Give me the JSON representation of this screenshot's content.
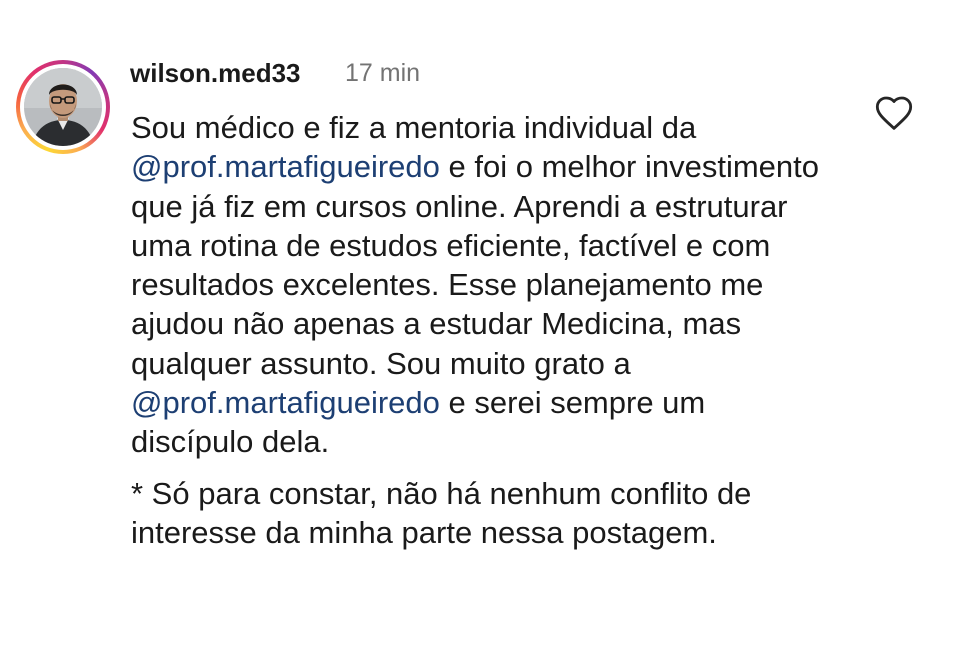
{
  "comment": {
    "username": "wilson.med33",
    "time": "17 min",
    "avatar_icon": "user-avatar-photo",
    "like_icon": "heart-outline-icon",
    "story_ring_colors": [
      "#fdd835",
      "#fbad50",
      "#e1306c",
      "#c13584",
      "#833ab4"
    ],
    "mention_color": "#1d3f73",
    "body": {
      "part1": "Sou médico e fiz a mentoria individual da",
      "mention1": "@prof.martafigueiredo",
      "part2": "e foi o melhor investimento que já fiz em cursos online. Aprendi a estruturar uma rotina de estudos eficiente, factível e com resultados excelentes. Esse planejamento me ajudou não apenas a estudar Medicina, mas qualquer assunto. Sou muito grato a",
      "mention2": "@prof.martafigueiredo",
      "part3": "e serei sempre um discípulo dela."
    },
    "note": "* Só para constar, não há nenhum conflito de interesse da minha parte nessa postagem."
  }
}
